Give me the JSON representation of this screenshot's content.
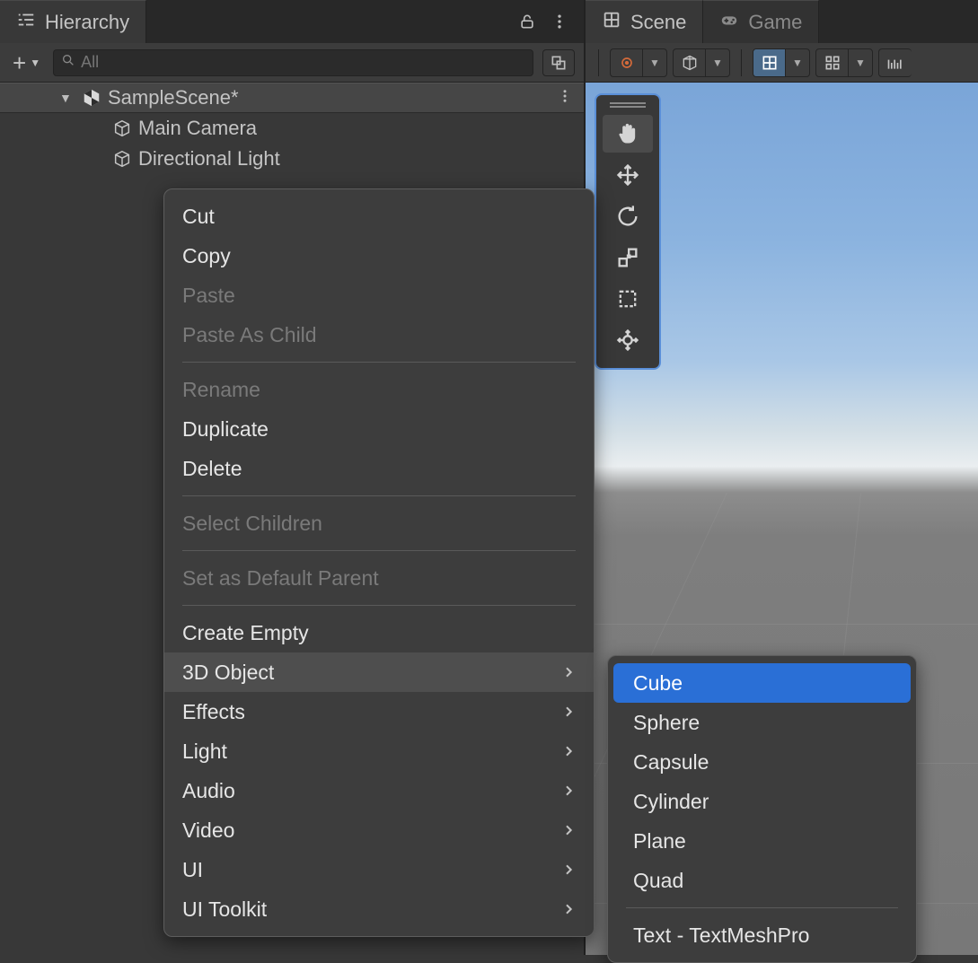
{
  "hierarchy": {
    "tab_label": "Hierarchy",
    "search_placeholder": "All",
    "scene": {
      "name": "SampleScene*",
      "children": [
        {
          "name": "Main Camera"
        },
        {
          "name": "Directional Light"
        }
      ]
    }
  },
  "scene_panel": {
    "tabs": [
      {
        "label": "Scene",
        "active": true
      },
      {
        "label": "Game",
        "active": false
      }
    ]
  },
  "context_menu": {
    "items": [
      {
        "label": "Cut",
        "disabled": false
      },
      {
        "label": "Copy",
        "disabled": false
      },
      {
        "label": "Paste",
        "disabled": true
      },
      {
        "label": "Paste As Child",
        "disabled": true
      },
      {
        "sep": true
      },
      {
        "label": "Rename",
        "disabled": true
      },
      {
        "label": "Duplicate",
        "disabled": false
      },
      {
        "label": "Delete",
        "disabled": false
      },
      {
        "sep": true
      },
      {
        "label": "Select Children",
        "disabled": true
      },
      {
        "sep": true
      },
      {
        "label": "Set as Default Parent",
        "disabled": true
      },
      {
        "sep": true
      },
      {
        "label": "Create Empty",
        "disabled": false
      },
      {
        "label": "3D Object",
        "submenu": true,
        "hover": true
      },
      {
        "label": "Effects",
        "submenu": true
      },
      {
        "label": "Light",
        "submenu": true
      },
      {
        "label": "Audio",
        "submenu": true
      },
      {
        "label": "Video",
        "submenu": true
      },
      {
        "label": "UI",
        "submenu": true
      },
      {
        "label": "UI Toolkit",
        "submenu": true
      }
    ]
  },
  "submenu_3d_object": {
    "items": [
      {
        "label": "Cube",
        "selected": true
      },
      {
        "label": "Sphere"
      },
      {
        "label": "Capsule"
      },
      {
        "label": "Cylinder"
      },
      {
        "label": "Plane"
      },
      {
        "label": "Quad"
      },
      {
        "sep": true
      },
      {
        "label": "Text - TextMeshPro"
      }
    ]
  },
  "scene_tools": [
    {
      "name": "hand",
      "active": true
    },
    {
      "name": "move"
    },
    {
      "name": "rotate"
    },
    {
      "name": "scale"
    },
    {
      "name": "rect"
    },
    {
      "name": "transform"
    }
  ]
}
